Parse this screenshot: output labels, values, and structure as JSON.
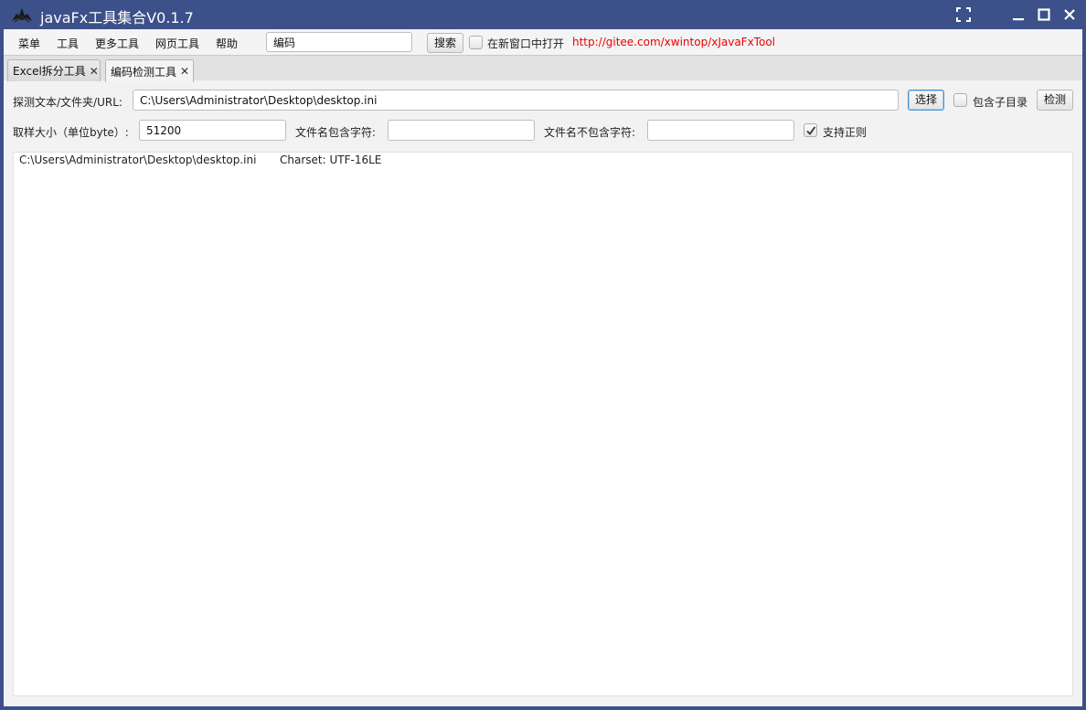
{
  "window": {
    "title": "javaFx工具集合V0.1.7",
    "app_icon": "app-logo-icon",
    "controls": [
      "fullscreen-icon",
      "minimize-icon",
      "maximize-icon",
      "close-icon"
    ],
    "colors": {
      "titlebar": "#3c5089",
      "link": "#e00000",
      "focus": "#4a8fd0"
    }
  },
  "menubar": {
    "items": [
      {
        "label": "菜单"
      },
      {
        "label": "工具"
      },
      {
        "label": "更多工具"
      },
      {
        "label": "网页工具"
      },
      {
        "label": "帮助"
      }
    ],
    "search": {
      "value": "编码",
      "placeholder": ""
    },
    "search_button": "搜索",
    "open_new_window": {
      "label": "在新窗口中打开",
      "checked": false
    },
    "link": "http://gitee.com/xwintop/xJavaFxTool"
  },
  "tabs": [
    {
      "label": "Excel拆分工具",
      "close": "✕",
      "active": false
    },
    {
      "label": "编码检测工具",
      "close": "✕",
      "active": true
    }
  ],
  "form": {
    "path_label": "探测文本/文件夹/URL:",
    "path_value": "C:\\Users\\Administrator\\Desktop\\desktop.ini",
    "choose_button": "选择",
    "include_subdir": {
      "label": "包含子目录",
      "checked": false
    },
    "detect_button": "检测",
    "sample_label": "取样大小（单位byte）:",
    "sample_value": "51200",
    "include_label": "文件名包含字符:",
    "include_value": "",
    "exclude_label": "文件名不包含字符:",
    "exclude_value": "",
    "regex": {
      "label": "支持正则",
      "checked": true
    }
  },
  "results": [
    {
      "path": "C:\\Users\\Administrator\\Desktop\\desktop.ini",
      "charset": "Charset: UTF-16LE"
    }
  ]
}
